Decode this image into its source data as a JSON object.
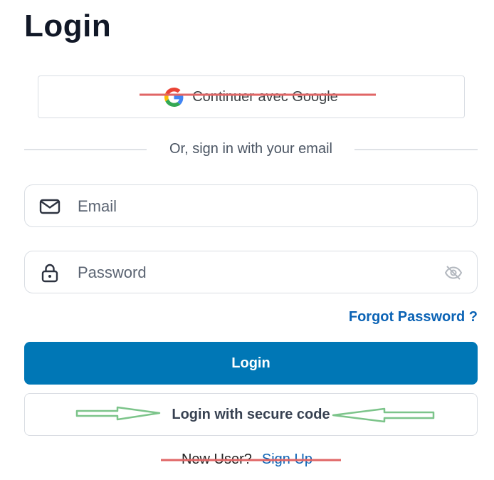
{
  "page": {
    "title": "Login"
  },
  "google": {
    "label": "Continuer avec Google",
    "icon": "google-g-icon"
  },
  "divider": {
    "text": "Or, sign in with your email"
  },
  "email": {
    "placeholder": "Email",
    "value": "",
    "icon": "mail-icon"
  },
  "password": {
    "placeholder": "Password",
    "value": "",
    "icon": "lock-icon",
    "toggle_icon": "eye-off-icon"
  },
  "forgot": {
    "label": "Forgot Password ?"
  },
  "login_button": {
    "label": "Login"
  },
  "secure_code_button": {
    "label": "Login with secure code"
  },
  "signup": {
    "question": "New User?",
    "link": "Sign Up"
  },
  "colors": {
    "primary": "#0077b6",
    "link": "#0b63b5",
    "strike_annotation": "#e06666",
    "arrow_annotation": "#7cc48a"
  }
}
